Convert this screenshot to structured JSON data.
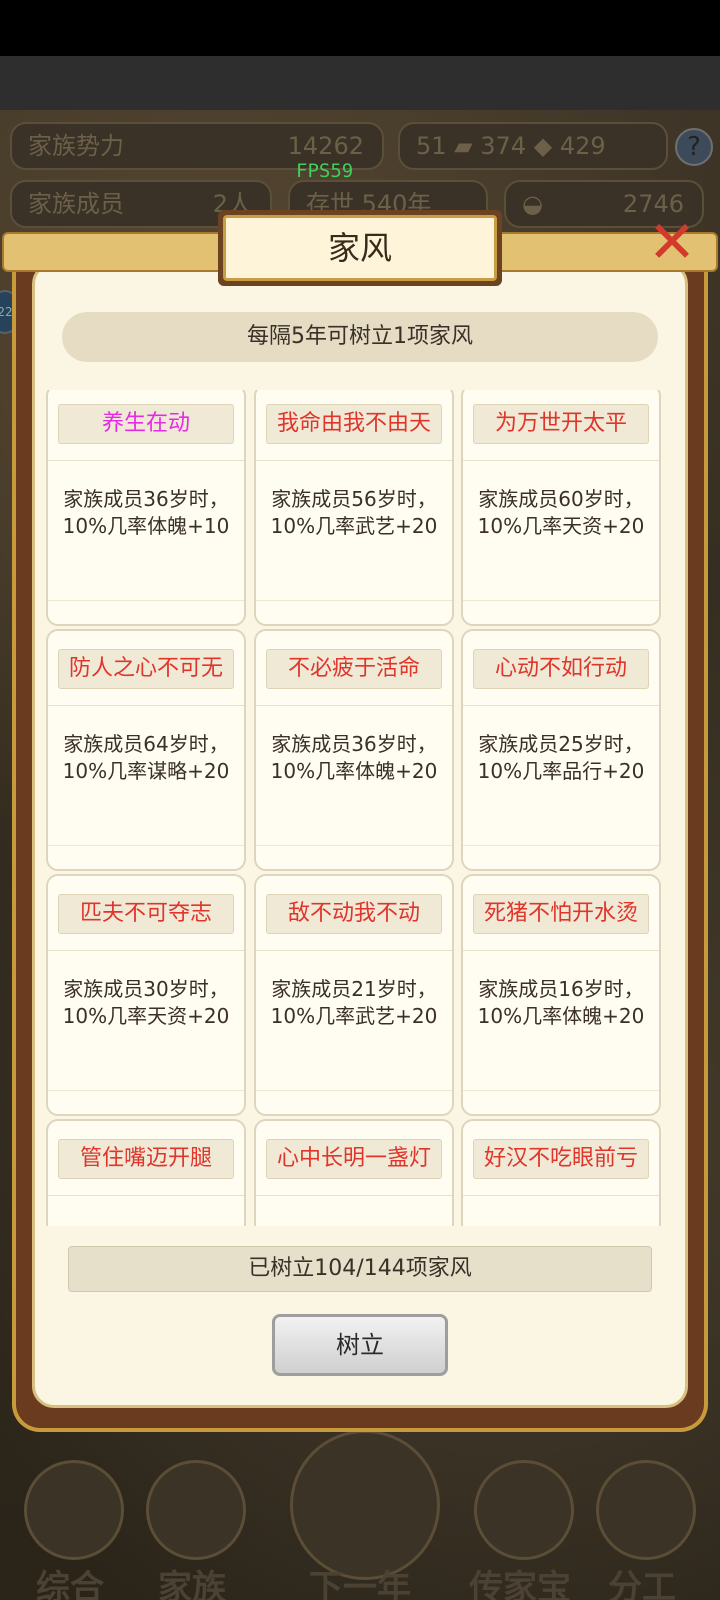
{
  "hud": {
    "power_label": "家族势力",
    "power_value": "14262",
    "members_label": "家族成员",
    "members_value": "2人",
    "alive_text": "存世 540年",
    "res_a": "51",
    "res_b": "374",
    "res_c": "429",
    "gold": "2746",
    "help": "?",
    "fps": "FPS59"
  },
  "dialog": {
    "title": "家风",
    "close": "✕",
    "info": "每隔5年可树立1项家风",
    "cards": [
      {
        "title": "养生在动",
        "desc": "家族成员36岁时，10%几率体魄+10",
        "color": "magenta"
      },
      {
        "title": "我命由我不由天",
        "desc": "家族成员56岁时，10%几率武艺+20",
        "color": "red"
      },
      {
        "title": "为万世开太平",
        "desc": "家族成员60岁时，10%几率天资+20",
        "color": "red"
      },
      {
        "title": "防人之心不可无",
        "desc": "家族成员64岁时，10%几率谋略+20",
        "color": "red"
      },
      {
        "title": "不必疲于活命",
        "desc": "家族成员36岁时，10%几率体魄+20",
        "color": "red"
      },
      {
        "title": "心动不如行动",
        "desc": "家族成员25岁时，10%几率品行+20",
        "color": "red"
      },
      {
        "title": "匹夫不可夺志",
        "desc": "家族成员30岁时，10%几率天资+20",
        "color": "red"
      },
      {
        "title": "敌不动我不动",
        "desc": "家族成员21岁时，10%几率武艺+20",
        "color": "red"
      },
      {
        "title": "死猪不怕开水烫",
        "desc": "家族成员16岁时，10%几率体魄+20",
        "color": "red"
      },
      {
        "title": "管住嘴迈开腿",
        "desc": "",
        "color": "red"
      },
      {
        "title": "心中长明一盏灯",
        "desc": "",
        "color": "red"
      },
      {
        "title": "好汉不吃眼前亏",
        "desc": "",
        "color": "red"
      }
    ],
    "count_text": "已树立104/144项家风",
    "action_label": "树立"
  },
  "nav": {
    "items": [
      "综合",
      "家族",
      "下一年",
      "传家宝",
      "分工"
    ]
  },
  "colors": {
    "title_red": "#e0352b",
    "title_magenta": "#e62ae6",
    "frame_brown": "#6b3b1f",
    "panel_cream": "#fbf6e3"
  }
}
